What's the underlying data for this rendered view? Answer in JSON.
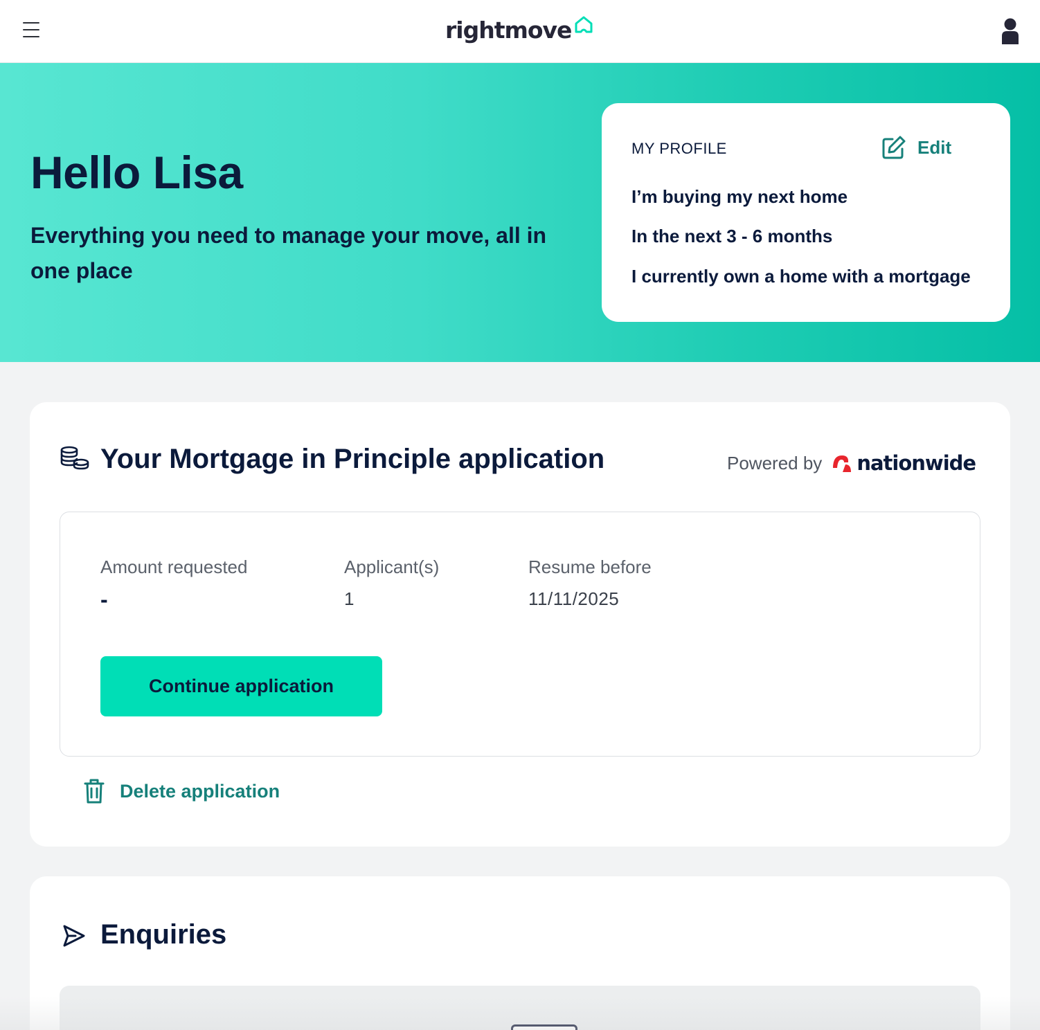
{
  "header": {
    "logo_text": "rightmove",
    "icons": {
      "menu": "hamburger-menu-icon",
      "logo_mark": "house-outline-icon",
      "account": "user-account-icon"
    },
    "brand_colors": {
      "accent": "#00deb6",
      "dark": "#262637",
      "link": "#16807a"
    }
  },
  "hero": {
    "title": "Hello Lisa",
    "subtitle": "Everything you need to manage your move, all in one place"
  },
  "profile": {
    "label": "MY PROFILE",
    "edit_label": "Edit",
    "lines": [
      "I’m buying my next home",
      "In the next 3 - 6 months",
      "I currently own a home with a mortgage"
    ]
  },
  "mortgage": {
    "title": "Your Mortgage in Principle application",
    "powered_by": "Powered by",
    "partner": "nationwide",
    "partner_color": "#e8252d",
    "stats": [
      {
        "label": "Amount requested",
        "value": "-"
      },
      {
        "label": "Applicant(s)",
        "value": "1"
      },
      {
        "label": "Resume before",
        "value": "11/11/2025"
      }
    ],
    "continue_label": "Continue application",
    "delete_label": "Delete application"
  },
  "enquiries": {
    "title": "Enquiries"
  }
}
